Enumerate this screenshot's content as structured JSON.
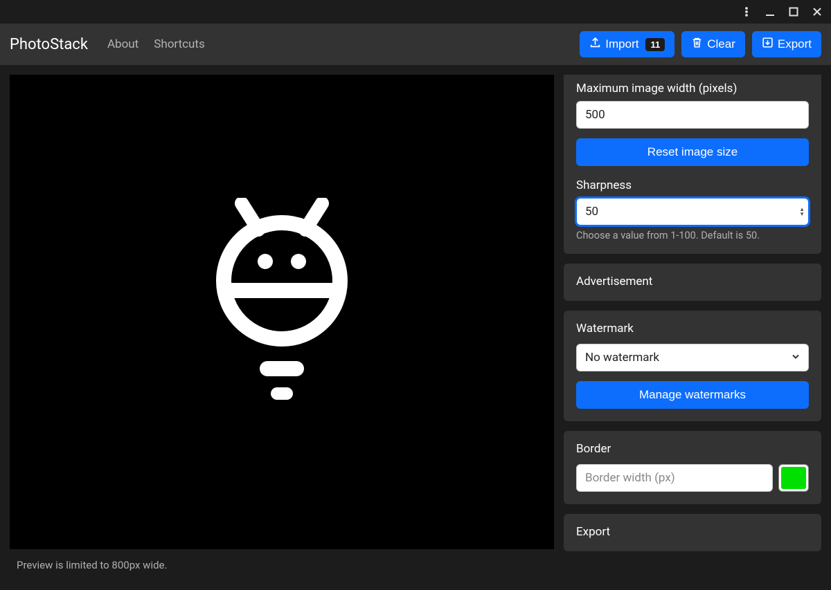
{
  "titlebar": {
    "kebab": "⋮",
    "minimize": "—",
    "maximize": "▢",
    "close": "✕"
  },
  "nav": {
    "brand": "PhotoStack",
    "about": "About",
    "shortcuts": "Shortcuts",
    "import": "Import",
    "import_count": "11",
    "clear": "Clear",
    "export": "Export"
  },
  "preview": {
    "note": "Preview is limited to 800px wide."
  },
  "resize": {
    "max_width_label": "Maximum image width (pixels)",
    "max_width_value": "500",
    "reset_label": "Reset image size",
    "sharpness_label": "Sharpness",
    "sharpness_value": "50",
    "sharpness_help": "Choose a value from 1-100. Default is 50."
  },
  "ad": {
    "title": "Advertisement"
  },
  "watermark": {
    "title": "Watermark",
    "selected": "No watermark",
    "manage": "Manage watermarks"
  },
  "border": {
    "title": "Border",
    "width_placeholder": "Border width (px)",
    "color": "#00e000"
  },
  "export_panel": {
    "title": "Export"
  }
}
